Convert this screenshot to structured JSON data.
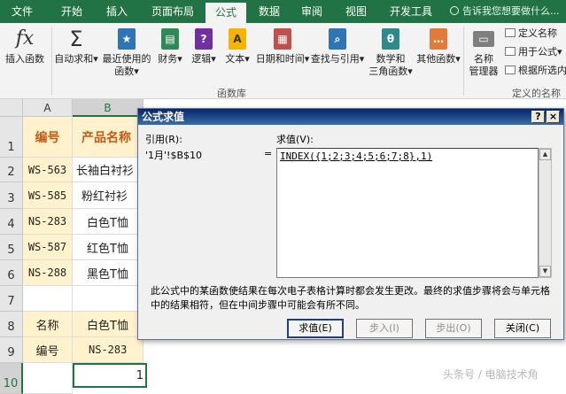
{
  "ribbon_tabs": [
    "文件",
    "开始",
    "插入",
    "页面布局",
    "公式",
    "数据",
    "审阅",
    "视图",
    "开发工具"
  ],
  "tell_me": "告诉我您想要做什么...",
  "ribbon": {
    "insert_function": "插入函数",
    "autosum": "自动求和",
    "recent_line1": "最近使用的",
    "recent_line2": "函数",
    "financial": "财务",
    "logical": "逻辑",
    "text": "文本",
    "datetime": "日期和时间",
    "lookup": "查找与引用",
    "math_line1": "数学和",
    "math_line2": "三角函数",
    "other": "其他函数",
    "library_label": "函数库",
    "name_mgr_line1": "名称",
    "name_mgr_line2": "管理器",
    "define_name": "定义名称",
    "use_in_formula": "用于公式",
    "create_from_selection": "根据所选内",
    "defined_names_label": "定义的名称",
    "dropdown_mark": "▾"
  },
  "columns": [
    "A",
    "B"
  ],
  "rows": [
    "1",
    "2",
    "3",
    "4",
    "5",
    "6",
    "7",
    "8",
    "9",
    "10"
  ],
  "cells": {
    "A1": "编号",
    "B1": "产品名称",
    "A2": "WS-563",
    "B2": "长袖白衬衫",
    "A3": "WS-585",
    "B3": "粉红衬衫",
    "A4": "NS-283",
    "B4": "白色T恤",
    "A5": "WS-587",
    "B5": "红色T恤",
    "A6": "NS-288",
    "B6": "黑色T恤",
    "A8": "名称",
    "B8": "白色T恤",
    "A9": "编号",
    "B9": "NS-283",
    "B10": "1"
  },
  "dialog": {
    "title": "公式求值",
    "help": "?",
    "close": "×",
    "ref_label": "引用(R):",
    "ref_value": "'1月'!$B$10",
    "equals": "=",
    "val_label": "求值(V):",
    "formula": "INDEX({1;2;3;4;5;6;7;8},1)",
    "description": "此公式中的某函数使结果在每次电子表格计算时都会发生更改。最终的求值步骤将会与单元格中的结果相符，但在中间步骤中可能会有所不同。",
    "buttons": {
      "evaluate": "求值(E)",
      "step_in": "步入(I)",
      "step_out": "步出(O)",
      "close": "关闭(C)"
    }
  },
  "watermark": "头条号 / 电脑技术角",
  "colors": {
    "excel_green": "#217346",
    "header_orange": "#c65911",
    "cell_yellow": "#fff2cc"
  }
}
